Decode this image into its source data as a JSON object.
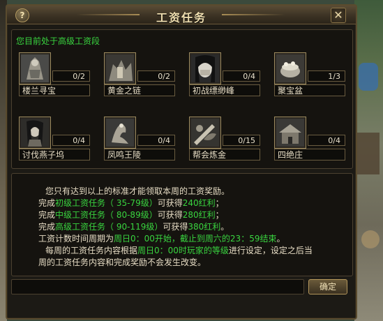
{
  "window": {
    "title": "工资任务",
    "help_label": "?",
    "close_label": "✕"
  },
  "tasks_panel": {
    "level_text": "您目前处于高级工资段",
    "tasks": [
      {
        "name": "楼兰寻宝",
        "count": "0/2",
        "icon": "warrior-statue-icon"
      },
      {
        "name": "黄金之链",
        "count": "0/2",
        "icon": "golden-chain-icon"
      },
      {
        "name": "初战缥缈峰",
        "count": "0/4",
        "icon": "masked-woman-icon"
      },
      {
        "name": "聚宝盆",
        "count": "1/3",
        "icon": "treasure-bowl-icon"
      },
      {
        "name": "讨伐燕子坞",
        "count": "0/4",
        "icon": "swordswoman-icon"
      },
      {
        "name": "凤鸣王陵",
        "count": "0/4",
        "icon": "phoenix-tomb-icon"
      },
      {
        "name": "帮会炼金",
        "count": "0/15",
        "icon": "alchemy-icon"
      },
      {
        "name": "四绝庄",
        "count": "0/4",
        "icon": "manor-icon"
      }
    ]
  },
  "info_panel": {
    "line1": "您只有达到以上的标准才能领取本周的工资奖励。",
    "line2": {
      "a": "完成",
      "b": "初级工资任务（ 35-79级）",
      "c": "可获得",
      "d": "240红利",
      "e": "；"
    },
    "line3": {
      "a": "完成",
      "b": "中级工资任务（ 80-89级）",
      "c": "可获得",
      "d": "280红利",
      "e": "；"
    },
    "line4": {
      "a": "完成",
      "b": "高级工资任务（ 90-119级）",
      "c": "可获得",
      "d": "380红利",
      "e": "。"
    },
    "line5": {
      "a": "工资计数时间周期为",
      "b": "周日0：00开始，截止到周六的23：59结束",
      "c": "。"
    },
    "line6": {
      "a": "每周的工资任务内容根据",
      "b": "周日0：00时玩家的等级",
      "c": "进行设定，设定之后当"
    },
    "line7": "周的工资任务内容和完成奖励不会发生改变。"
  },
  "bottom": {
    "ok_label": "确定"
  },
  "colors": {
    "highlight": "#39d43f",
    "text": "#e6dcc4",
    "title": "#f0dfb0"
  }
}
